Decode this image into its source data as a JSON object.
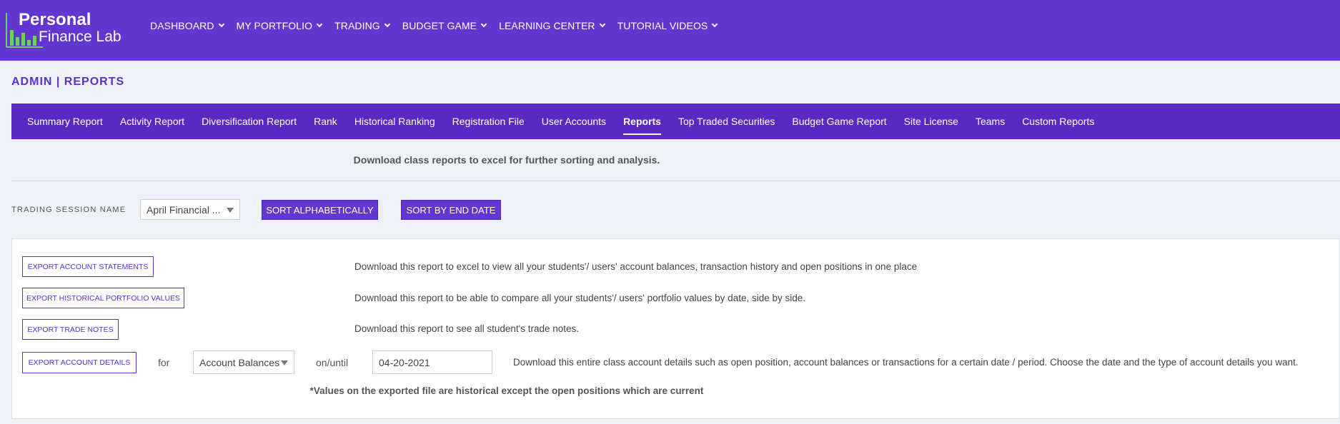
{
  "brand": {
    "line1": "Personal",
    "line2": "Finance Lab",
    "logo_color": "#6fcf60"
  },
  "nav": [
    {
      "label": "DASHBOARD"
    },
    {
      "label": "MY PORTFOLIO"
    },
    {
      "label": "TRADING"
    },
    {
      "label": "BUDGET GAME"
    },
    {
      "label": "LEARNING CENTER"
    },
    {
      "label": "TUTORIAL VIDEOS"
    }
  ],
  "page_title": "ADMIN | REPORTS",
  "tabs": [
    {
      "label": "Summary Report"
    },
    {
      "label": "Activity Report"
    },
    {
      "label": "Diversification Report"
    },
    {
      "label": "Rank"
    },
    {
      "label": "Historical Ranking"
    },
    {
      "label": "Registration File"
    },
    {
      "label": "User Accounts"
    },
    {
      "label": "Reports",
      "active": true
    },
    {
      "label": "Top Traded Securities"
    },
    {
      "label": "Budget Game Report"
    },
    {
      "label": "Site License"
    },
    {
      "label": "Teams"
    },
    {
      "label": "Custom Reports"
    }
  ],
  "intro": "Download class reports to excel for further sorting and analysis.",
  "session": {
    "label": "TRADING SESSION NAME",
    "selected": "April Financial ...",
    "sort_alpha": "SORT ALPHABETICALLY",
    "sort_end": "SORT BY END DATE"
  },
  "exports": {
    "account_statements": {
      "button": "EXPORT ACCOUNT STATEMENTS",
      "desc": "Download this report to excel to view all your students'/ users' account balances, transaction history and open positions in one place"
    },
    "historical_values": {
      "button": "EXPORT HISTORICAL PORTFOLIO VALUES",
      "desc": "Download this report to be able to compare all your students'/ users' portfolio values by date, side by side."
    },
    "trade_notes": {
      "button": "EXPORT TRADE NOTES",
      "desc": "Download this report to see all student's trade notes."
    },
    "account_details": {
      "button": "EXPORT ACCOUNT DETAILS",
      "for_label": "for",
      "type_selected": "Account Balances",
      "until_label": "on/until",
      "date_value": "04-20-2021",
      "desc": "Download this entire class account details such as open position, account balances or transactions for a certain date / period. Choose the date and the type of account details you want."
    }
  },
  "footnote": "*Values on the exported file are historical except the open positions which are current",
  "colors": {
    "primary": "#6236d0",
    "tabs_bg": "#5a29c3",
    "page_bg": "#eef1f6"
  }
}
